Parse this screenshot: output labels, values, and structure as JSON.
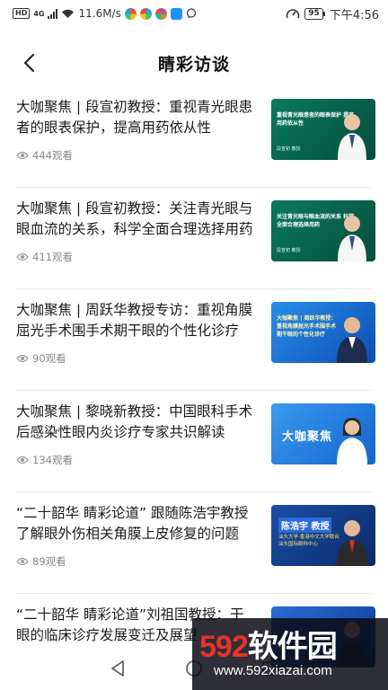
{
  "status_bar": {
    "hd": "HD",
    "signal": "4G",
    "speed": "11.6M/s",
    "battery": "95",
    "time": "下午4:56"
  },
  "header": {
    "title": "睛彩访谈"
  },
  "articles": [
    {
      "title": "大咖聚焦 | 段宣初教授：重视青光眼患者的眼表保护，提高用药依从性",
      "views": "444观看",
      "thumb_text": "重视青光眼患者的眼表保护 提高用药依从性",
      "thumb_sub": "段宣初 教授"
    },
    {
      "title": "大咖聚焦 | 段宣初教授：关注青光眼与眼血流的关系，科学全面合理选择用药",
      "views": "411观看",
      "thumb_text": "关注青光眼与眼血流的关系 科学全面合理选择用药",
      "thumb_sub": "段宣初 教授"
    },
    {
      "title": "大咖聚焦 | 周跃华教授专访：重视角膜屈光手术围手术期干眼的个性化诊疗",
      "views": "90观看",
      "thumb_text": "大咖聚焦 | 周跃华教授：重视角膜屈光手术围手术期干眼的个性化诊疗",
      "thumb_sub": ""
    },
    {
      "title": "大咖聚焦 | 黎晓新教授：中国眼科手术后感染性眼内炎诊疗专家共识解读",
      "views": "134观看",
      "thumb_text": "大咖聚焦",
      "thumb_sub": ""
    },
    {
      "title": "“二十韶华 睛彩论道” 跟随陈浩宇教授了解眼外伤相关角膜上皮修复的问题",
      "views": "89观看",
      "thumb_text": "陈浩宇 教授",
      "thumb_sub": "汕头大学·香港中文大学联合汕头国际眼科中心"
    },
    {
      "title": "“二十韶华 睛彩论道”刘祖国教授：干眼的临床诊疗发展变迁及展望",
      "views": "",
      "thumb_text": "",
      "thumb_sub": ""
    }
  ],
  "watermark": {
    "big_num": "592",
    "big_text": "软件园",
    "url": "www.592xiazai.com"
  },
  "colors": {
    "thumb_green": "#0b6e55",
    "thumb_blue": "#1f6fd6",
    "accent_red": "#e8322c"
  }
}
